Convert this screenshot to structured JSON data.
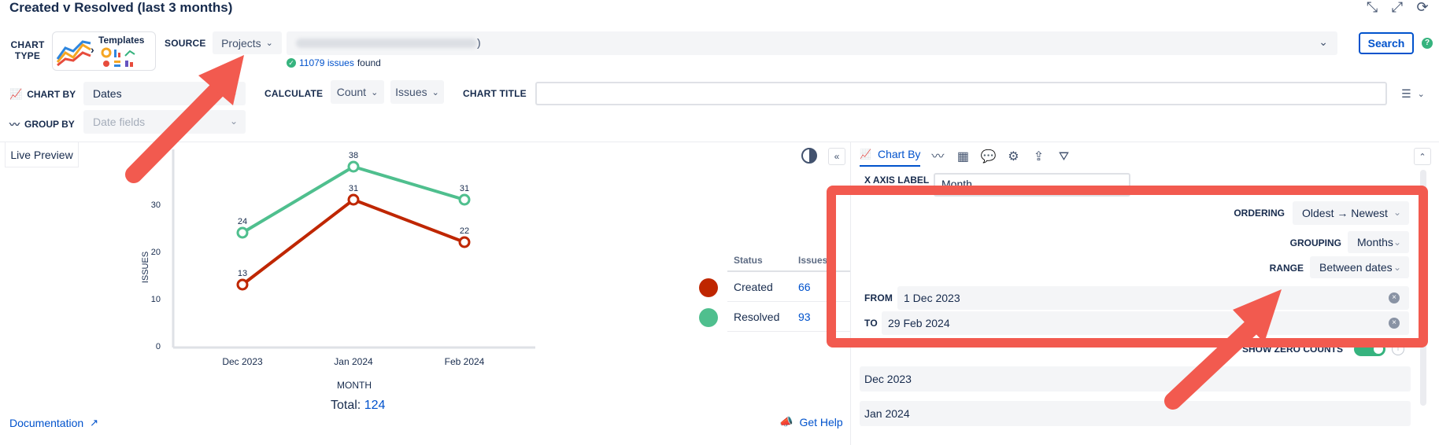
{
  "header": {
    "title": "Created v Resolved (last 3 months)",
    "icons": [
      "shrink-icon",
      "compress-icon",
      "refresh-icon"
    ]
  },
  "toolbar": {
    "chart_type_label": "CHART TYPE",
    "templates_label": "Templates",
    "source_label": "SOURCE",
    "source_value": "Projects",
    "jql_suffix": ")",
    "search_label": "Search",
    "help_label": "?",
    "issues_count_link": "11079 issues",
    "issues_found_text": "found"
  },
  "row2": {
    "chart_by_label": "CHART BY",
    "chart_by_value": "Dates",
    "calculate_label": "CALCULATE",
    "calc_count": "Count",
    "calc_issues": "Issues",
    "chart_title_label": "CHART TITLE",
    "chart_title_value": ""
  },
  "row3": {
    "group_by_label": "GROUP BY",
    "group_by_placeholder": "Date fields"
  },
  "preview": {
    "tab_label": "Live Preview",
    "total_label": "Total:",
    "total_value": "124",
    "documentation": "Documentation",
    "get_help": "Get Help"
  },
  "chart_data": {
    "type": "line",
    "categories": [
      "Dec 2023",
      "Jan 2024",
      "Feb 2024"
    ],
    "series": [
      {
        "name": "Created",
        "values": [
          13,
          31,
          22
        ],
        "color": "#bf2600"
      },
      {
        "name": "Resolved",
        "values": [
          24,
          38,
          31
        ],
        "color": "#4fbf8e"
      }
    ],
    "xlabel": "MONTH",
    "ylabel": "ISSUES",
    "yticks": [
      0,
      10,
      20,
      30
    ],
    "ylim": [
      0,
      40
    ]
  },
  "legend": {
    "col_status": "Status",
    "col_issues": "Issues",
    "rows": [
      {
        "status": "Created",
        "issues": "66",
        "color": "#bf2600"
      },
      {
        "status": "Resolved",
        "issues": "93",
        "color": "#4fbf8e"
      }
    ]
  },
  "panel": {
    "active_tab": "Chart By",
    "x_axis_label": "X AXIS LABEL",
    "x_axis_value": "Month",
    "ordering_label": "ORDERING",
    "ordering_value": "Oldest → Newest",
    "grouping_label": "GROUPING",
    "grouping_value": "Months",
    "range_label": "RANGE",
    "range_value": "Between dates",
    "from_label": "FROM",
    "from_value": "1 Dec 2023",
    "to_label": "TO",
    "to_value": "29 Feb 2024",
    "show_zero_label": "SHOW ZERO COUNTS",
    "months": [
      "Dec 2023",
      "Jan 2024"
    ]
  }
}
